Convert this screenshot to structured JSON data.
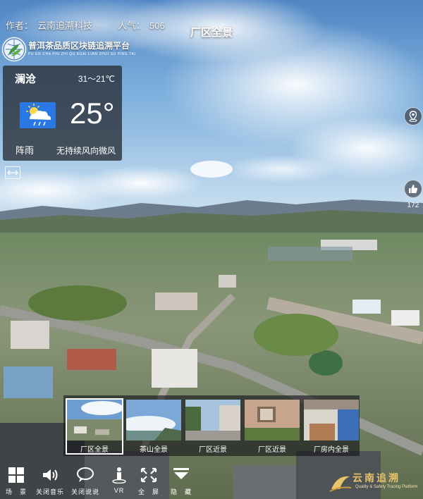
{
  "header": {
    "author_label": "作者：",
    "author_name": "云南追溯科技",
    "popularity_label": "人气：",
    "popularity_value": "506",
    "scene_title": "厂区全景"
  },
  "logo": {
    "name": "普洱茶品质区块链追溯平台",
    "subtitle": "PU ER CHA PIN ZHI QU KUAI LIAN ZHUI SU PING TAI"
  },
  "weather": {
    "city": "澜沧",
    "range": "31～21℃",
    "temperature": "25°",
    "condition": "阵雨",
    "wind": "无持续风向微风",
    "icon": "cloud-sun-rain-icon",
    "icon_color": "#2a78e4"
  },
  "likes": {
    "count": "172"
  },
  "scenes": [
    {
      "label": "厂区全景",
      "active": true
    },
    {
      "label": "茶山全景",
      "active": false
    },
    {
      "label": "厂区近景",
      "active": false
    },
    {
      "label": "厂区近景",
      "active": false
    },
    {
      "label": "厂房内全景",
      "active": false
    }
  ],
  "toolbar": [
    {
      "label": "场　景",
      "icon": "grid-icon"
    },
    {
      "label": "关闭音乐",
      "icon": "speaker-icon"
    },
    {
      "label": "关闭说说",
      "icon": "chat-bubble-icon"
    },
    {
      "label": "VR",
      "icon": "vr-person-icon"
    },
    {
      "label": "全　屏",
      "icon": "fullscreen-icon"
    },
    {
      "label": "隐　藏",
      "icon": "hide-icon"
    }
  ],
  "brand": {
    "name": "云南追溯",
    "tagline": "Quality & Safety Tracing Platform",
    "accent": "#e8c36a"
  }
}
